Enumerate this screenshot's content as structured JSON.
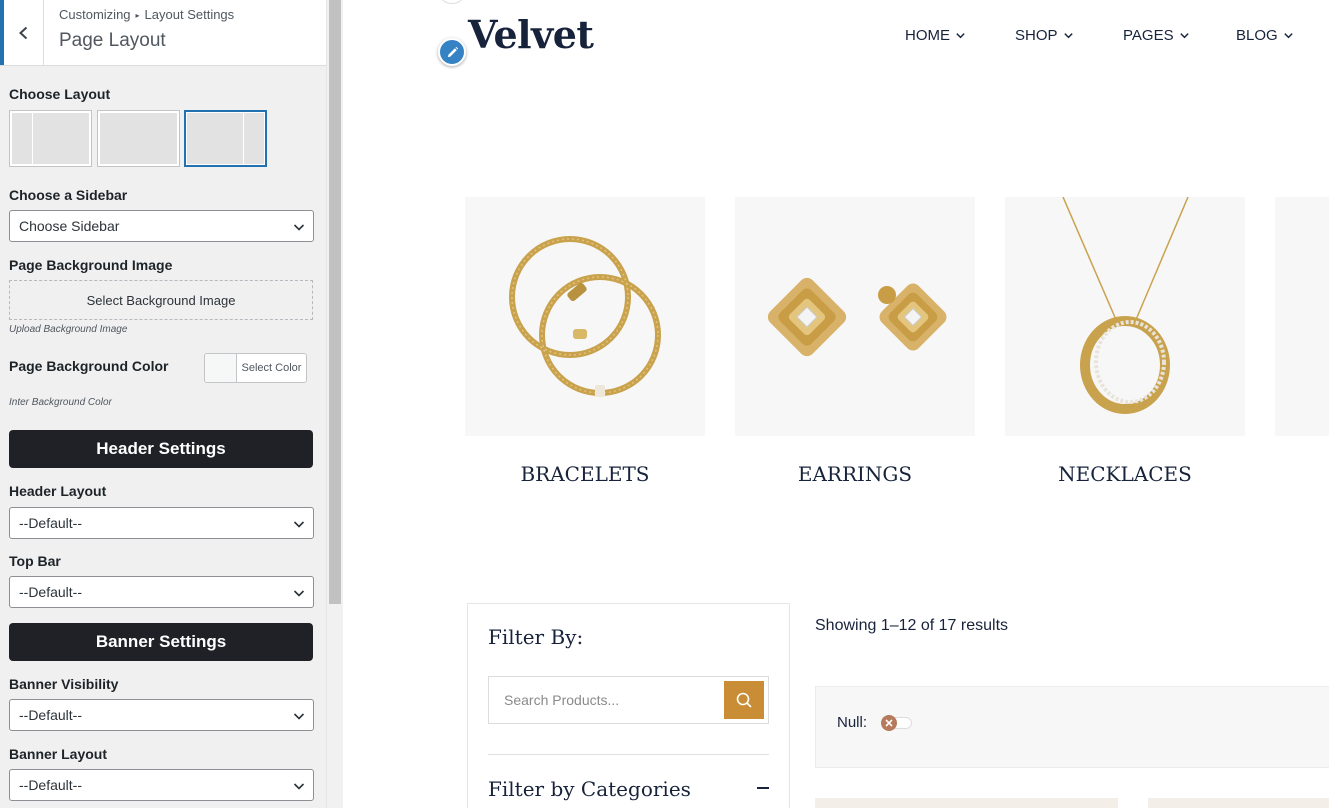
{
  "panel": {
    "breadcrumb_root": "Customizing",
    "breadcrumb_current": "Layout Settings",
    "title": "Page Layout",
    "choose_layout_label": "Choose Layout",
    "layouts": [
      {
        "name": "left-sidebar",
        "selected": false
      },
      {
        "name": "no-sidebar",
        "selected": false
      },
      {
        "name": "right-sidebar",
        "selected": true
      }
    ],
    "sidebar_label": "Choose a Sidebar",
    "sidebar_value": "Choose Sidebar",
    "bg_image_label": "Page Background Image",
    "bg_image_button": "Select Background Image",
    "bg_image_hint": "Upload Background Image",
    "bg_color_label": "Page Background Color",
    "bg_color_button": "Select Color",
    "bg_color_hint": "Inter Background Color",
    "header_settings": "Header Settings",
    "header_layout_label": "Header Layout",
    "header_layout_value": "--Default--",
    "top_bar_label": "Top Bar",
    "top_bar_value": "--Default--",
    "banner_settings": "Banner Settings",
    "banner_visibility_label": "Banner Visibility",
    "banner_visibility_value": "--Default--",
    "banner_layout_label": "Banner Layout",
    "banner_layout_value": "--Default--"
  },
  "site": {
    "logo": "Velvet",
    "nav": [
      "HOME",
      "SHOP",
      "PAGES",
      "BLOG"
    ],
    "categories": [
      "BRACELETS",
      "EARRINGS",
      "NECKLACES"
    ],
    "filter_title": "Filter By:",
    "search_placeholder": "Search Products...",
    "categories_filter_title": "Filter by Categories",
    "results": "Showing 1–12 of 17 results",
    "active_filter_label": "Null:"
  },
  "colors": {
    "accent": "#2271b1",
    "section_button_bg": "#1f2126",
    "brand_navy": "#17223b",
    "search_button": "#c88d35",
    "gold": "#c9a24d"
  }
}
